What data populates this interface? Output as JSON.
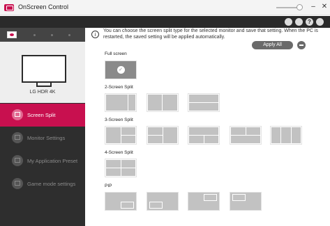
{
  "window": {
    "title": "OnScreen Control",
    "min_label": "–",
    "close_label": "✕"
  },
  "topbar": {
    "icons": [
      "cursor-icon",
      "display-icon",
      "help-icon",
      "settings-icon"
    ],
    "help_label": "?"
  },
  "sidebar": {
    "monitor_name": "LG HDR 4K",
    "nav": [
      {
        "label": "Screen Split",
        "icon": "screen-split-icon",
        "active": true
      },
      {
        "label": "Monitor Settings",
        "icon": "monitor-settings-icon",
        "active": false
      },
      {
        "label": "My Application Preset",
        "icon": "application-preset-icon",
        "active": false
      },
      {
        "label": "Game mode settings",
        "icon": "gamepad-icon",
        "active": false
      }
    ]
  },
  "main": {
    "info_symbol": "i",
    "info_text": "You can choose the screen split type for the selected monitor and save that setting. When the PC is restarted, the saved setting will be applied automatically.",
    "apply_all_label": "Apply All",
    "sections": {
      "full": "Full screen",
      "two": "2-Screen Split",
      "three": "3-Screen Split",
      "four": "4-Screen Split",
      "pip": "PIP"
    },
    "selected_check": "✓"
  },
  "colors": {
    "accent": "#c8104f",
    "sidebar_bg": "#2e2e2e",
    "layout_gray": "#c2c2c2",
    "selected_gray": "#8a8a8a"
  }
}
